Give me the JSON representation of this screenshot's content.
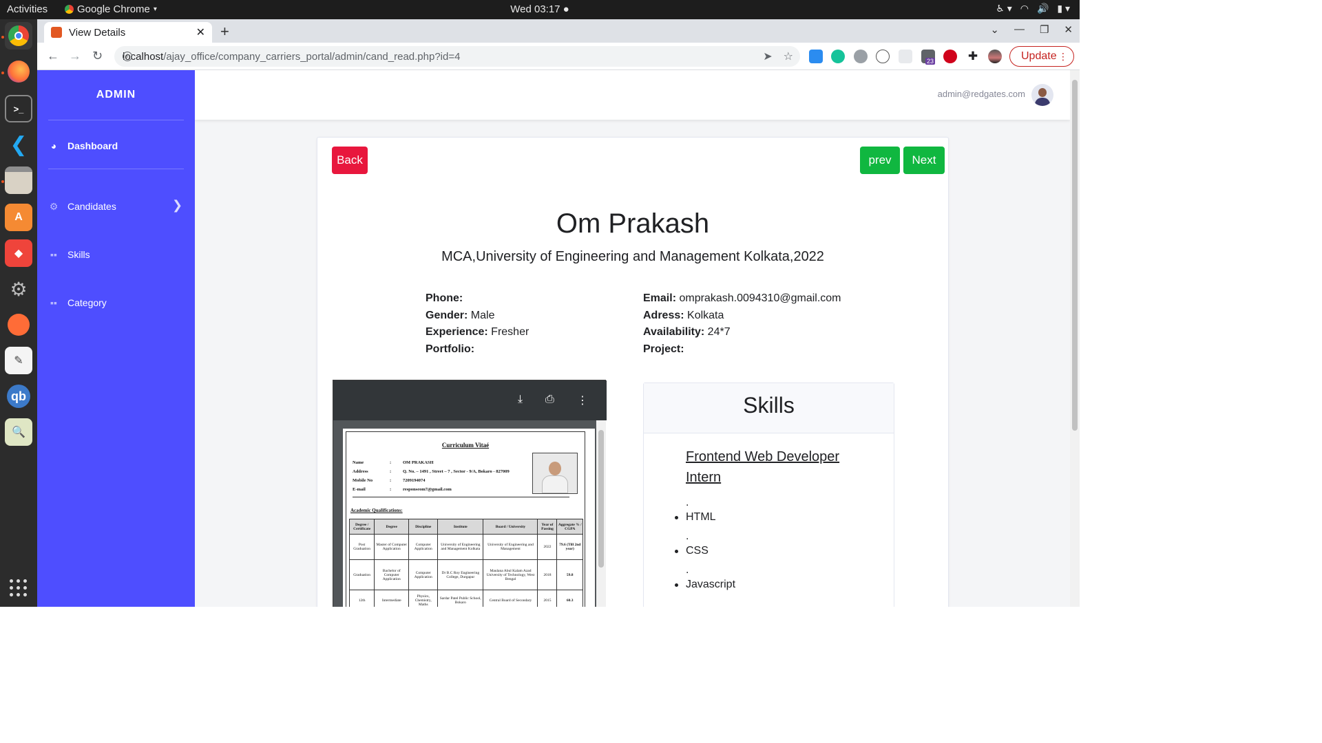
{
  "os": {
    "activities": "Activities",
    "app_menu": "Google Chrome",
    "clock": "Wed 03:17"
  },
  "browser": {
    "tab_title": "View Details",
    "url_host": "localhost",
    "url_path": "/ajay_office/company_carriers_portal/admin/cand_read.php?id=4",
    "ext_badge": "23",
    "update_label": "Update"
  },
  "sidebar": {
    "brand": "ADMIN",
    "items": [
      {
        "label": "Dashboard",
        "icon": "dashboard-icon"
      },
      {
        "label": "Candidates",
        "icon": "gear-icon"
      },
      {
        "label": "Skills",
        "icon": "cubes-icon"
      },
      {
        "label": "Category",
        "icon": "cubes-icon"
      }
    ],
    "accent": "#4e4eff"
  },
  "header": {
    "user_email": "admin@redgates.com"
  },
  "actions": {
    "back": "Back",
    "prev": "prev",
    "next": "Next",
    "back_color": "#e8173d",
    "nav_color": "#10b740"
  },
  "candidate": {
    "name": "Om Prakash",
    "education": "MCA,University of Engineering and Management Kolkata,2022",
    "left": [
      {
        "key": "Phone:",
        "value": ""
      },
      {
        "key": "Gender:",
        "value": "Male"
      },
      {
        "key": "Experience:",
        "value": "Fresher"
      },
      {
        "key": "Portfolio:",
        "value": ""
      }
    ],
    "right": [
      {
        "key": "Email:",
        "value": "omprakash.0094310@gmail.com"
      },
      {
        "key": "Adress:",
        "value": "Kolkata"
      },
      {
        "key": "Availability:",
        "value": "24*7"
      },
      {
        "key": "Project:",
        "value": ""
      }
    ]
  },
  "resume": {
    "title": "Curriculum Vitaé",
    "fields": [
      {
        "k": "Name",
        "v": "OM PRAKASH"
      },
      {
        "k": "Address",
        "v": "Q. No. – 1491 , Street – 7 , Sector - 9/A, Bokaro - 827009"
      },
      {
        "k": "Mobile No",
        "v": "7209194074"
      },
      {
        "k": "E-mail",
        "v": "responseom7@gmail.com"
      }
    ],
    "section": "Academic Qualifications:",
    "headers": [
      "Degree / Certificate",
      "Degree",
      "Discipline",
      "Institute",
      "Board / University",
      "Year of Passing",
      "Aggregate % / CGPA"
    ],
    "rows": [
      [
        "Post Graduation",
        "Master of Computer Application",
        "Computer Application",
        "University of Engineering and Management Kolkata",
        "University of Engineering and Management",
        "2022",
        "79.6 (Till 2nd year)"
      ],
      [
        "Graduation",
        "Bachelor of Computer Application",
        "Computer Application",
        "Dr B.C Roy Engineering College, Durgapur",
        "Maulana Abul Kalam Azad University of Technology, West Bengal",
        "2018",
        "59.8"
      ],
      [
        "12th",
        "Intermediate",
        "Physics, Chemistry, Maths",
        "Sardar Patel Public School, Bokaro",
        "Central Board of Secondary",
        "2015",
        "60.3"
      ]
    ]
  },
  "skills": {
    "title": "Skills",
    "role": "Frontend Web Developer Intern",
    "items": [
      {
        "dot": ".",
        "label": "HTML"
      },
      {
        "dot": ".",
        "label": "CSS"
      },
      {
        "dot": ".",
        "label": "Javascript"
      }
    ]
  }
}
